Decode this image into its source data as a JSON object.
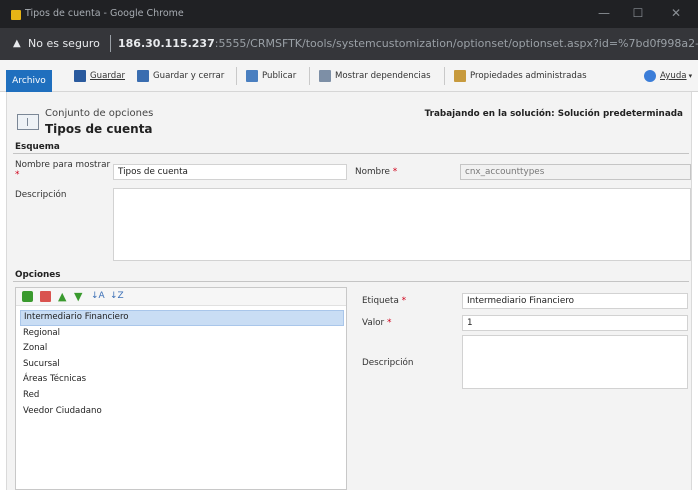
{
  "browser": {
    "window_title": "Tipos de cuenta - Google Chrome",
    "not_secure": "No es seguro",
    "url_host": "186.30.115.237",
    "url_rest": ":5555/CRMSFTK/tools/systemcustomization/optionset/optionset.aspx?id=%7bd0f998a2-..."
  },
  "ribbon": {
    "archivo": "Archivo",
    "guardar": "Guardar",
    "guardar_cerrar": "Guardar y cerrar",
    "publicar": "Publicar",
    "mostrar_dependencias": "Mostrar dependencias",
    "propiedades": "Propiedades administradas",
    "ayuda": "Ayuda"
  },
  "header": {
    "subtitle": "Conjunto de opciones",
    "title": "Tipos de cuenta",
    "solution": "Trabajando en la solución: Solución predeterminada"
  },
  "schema": {
    "section": "Esquema",
    "display_name_label": "Nombre para mostrar",
    "display_name_value": "Tipos de cuenta",
    "name_label": "Nombre",
    "name_value": "cnx_accounttypes",
    "description_label": "Descripción"
  },
  "options": {
    "section": "Opciones",
    "items": [
      "Intermediario Financiero",
      "Regional",
      "Zonal",
      "Sucursal",
      "Áreas Técnicas",
      "Red",
      "Veedor Ciudadano"
    ],
    "selected_index": 0,
    "label_label": "Etiqueta",
    "label_value": "Intermediario Financiero",
    "value_label": "Valor",
    "value_value": "1",
    "description_label": "Descripción"
  },
  "colors": {
    "accent": "#1f6fbe",
    "required": "#d0021b",
    "selection": "#c9ddf4"
  }
}
